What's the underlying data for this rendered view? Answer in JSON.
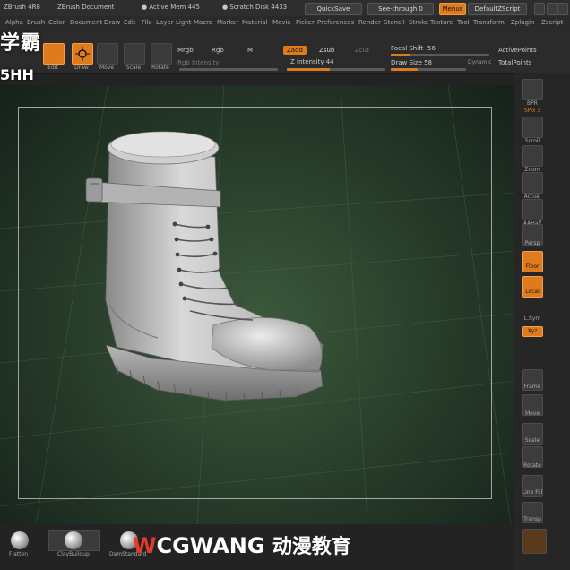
{
  "titlebar": {
    "app_version": "ZBrush 4R8",
    "doc_title": "ZBrush Document",
    "active_mem": "● Active Mem 445",
    "scratch_disk": "● Scratch Disk 4433",
    "quicksave": "QuickSave",
    "see_through": "See-through 0",
    "menus": "Menus",
    "default_script": "DefaultZScript"
  },
  "menus": [
    "Alpha",
    "Brush",
    "Color",
    "Document",
    "Draw",
    "Edit",
    "File",
    "Layer",
    "Light",
    "Macro",
    "Marker",
    "Material",
    "Movie",
    "Picker",
    "Preferences",
    "Render",
    "Stencil",
    "Stroke",
    "Texture",
    "Tool",
    "Transform",
    "Zplugin",
    "Zscript"
  ],
  "shelf": {
    "tools": [
      "Edit",
      "Draw",
      "Move",
      "Scale",
      "Rotate"
    ],
    "mrgb": "Mrgb",
    "rgb": "Rgb",
    "m": "M",
    "zadd": "Zadd",
    "zsub": "Zsub",
    "zcut": "Zcut",
    "rgb_intensity": "Rgb Intensity",
    "z_intensity": "Z Intensity 44",
    "focal_shift": "Focal Shift -56",
    "draw_size": "Draw Size 58",
    "dynamic": "Dynamic",
    "active_points": "ActivePoints",
    "total_points": "TotalPoints"
  },
  "watermark": {
    "line1": "学霸",
    "line2": "5HH"
  },
  "right_shelf": [
    "BPR",
    "SPix 3",
    "Scroll",
    "Zoom",
    "Actual",
    "AAHalf",
    "Persp",
    "Floor",
    "Local",
    "L.Sym",
    "Xyz",
    "Frame",
    "Move",
    "Scale",
    "Rotate",
    "Line Fill",
    "Transp"
  ],
  "bottom": {
    "materials": [
      "Flatten",
      "ClayBuildup",
      "DamStandard"
    ],
    "brand_w": "W",
    "brand_rest": "CGWANG",
    "brand_cn": "动漫教育"
  },
  "colors": {
    "accent": "#e07b1d",
    "viewport_center": "#3c5a3c",
    "viewport_edge": "#15211a",
    "ui_bg": "#2b2b2b"
  }
}
